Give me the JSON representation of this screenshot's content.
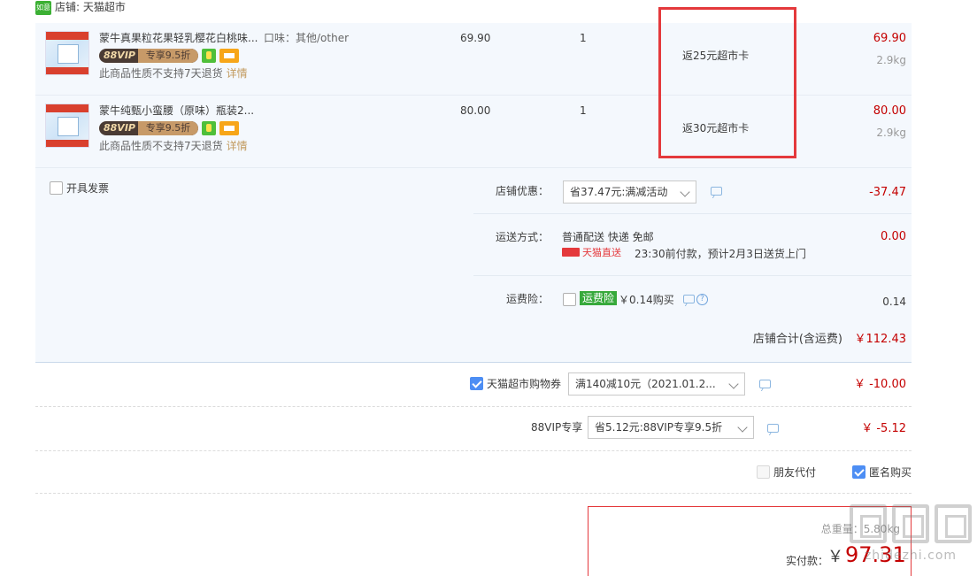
{
  "shop": {
    "icon_text": "如意",
    "name": "店铺: 天猫超市"
  },
  "items": [
    {
      "title": "蒙牛真果粒花果轻乳樱花白桃味...",
      "spec": "口味：其他/other",
      "vip_a": "88VIP",
      "vip_b": "专享9.5折",
      "note": "此商品性质不支持7天退货",
      "note_link": "详情",
      "price": "69.90",
      "qty": "1",
      "promo": "返25元超市卡",
      "total": "69.90",
      "weight": "2.9kg"
    },
    {
      "title": "蒙牛纯甄小蛮腰（原味）瓶装2...",
      "spec": "",
      "vip_a": "88VIP",
      "vip_b": "专享9.5折",
      "note": "此商品性质不支持7天退货",
      "note_link": "详情",
      "price": "80.00",
      "qty": "1",
      "promo": "返30元超市卡",
      "total": "80.00",
      "weight": "2.9kg"
    }
  ],
  "invoice": {
    "label": "开具发票"
  },
  "shop_discount": {
    "label": "店铺优惠：",
    "selected": "省37.47元:满减活动",
    "amount": "-37.47"
  },
  "shipping": {
    "label": "运送方式：",
    "method": "普通配送 快递 免邮",
    "tag": "天猫直送",
    "eta": "23:30前付款，预计2月3日送货上门",
    "amount": "0.00"
  },
  "insurance": {
    "label": "运费险：",
    "tag": "运费险",
    "price": "￥0.14购买",
    "help": "?",
    "amount": "0.14"
  },
  "store_total": {
    "label": "店铺合计(含运费)",
    "value": "￥112.43"
  },
  "coupon": {
    "label": "天猫超市购物券",
    "selected": "满140减10元（2021.01.2...",
    "amount": "￥ -10.00"
  },
  "vip_discount": {
    "label": "88VIP专享",
    "selected": "省5.12元:88VIP专享9.5折",
    "amount": "￥ -5.12"
  },
  "pay_options": {
    "friend_pay": "朋友代付",
    "anonymous": "匿名购买"
  },
  "payment": {
    "weight_label": "总重量：",
    "weight_value": "5.80kg",
    "paid_label": "实付款：",
    "currency": "￥",
    "paid_value": "97.31"
  },
  "watermark": {
    "text": "zhidezhi.com"
  },
  "colors": {
    "accent_red": "#c40000",
    "frame_red": "#e4393c",
    "checkbox_blue": "#4d8ef4",
    "panel_bg": "#f4f8fd"
  }
}
